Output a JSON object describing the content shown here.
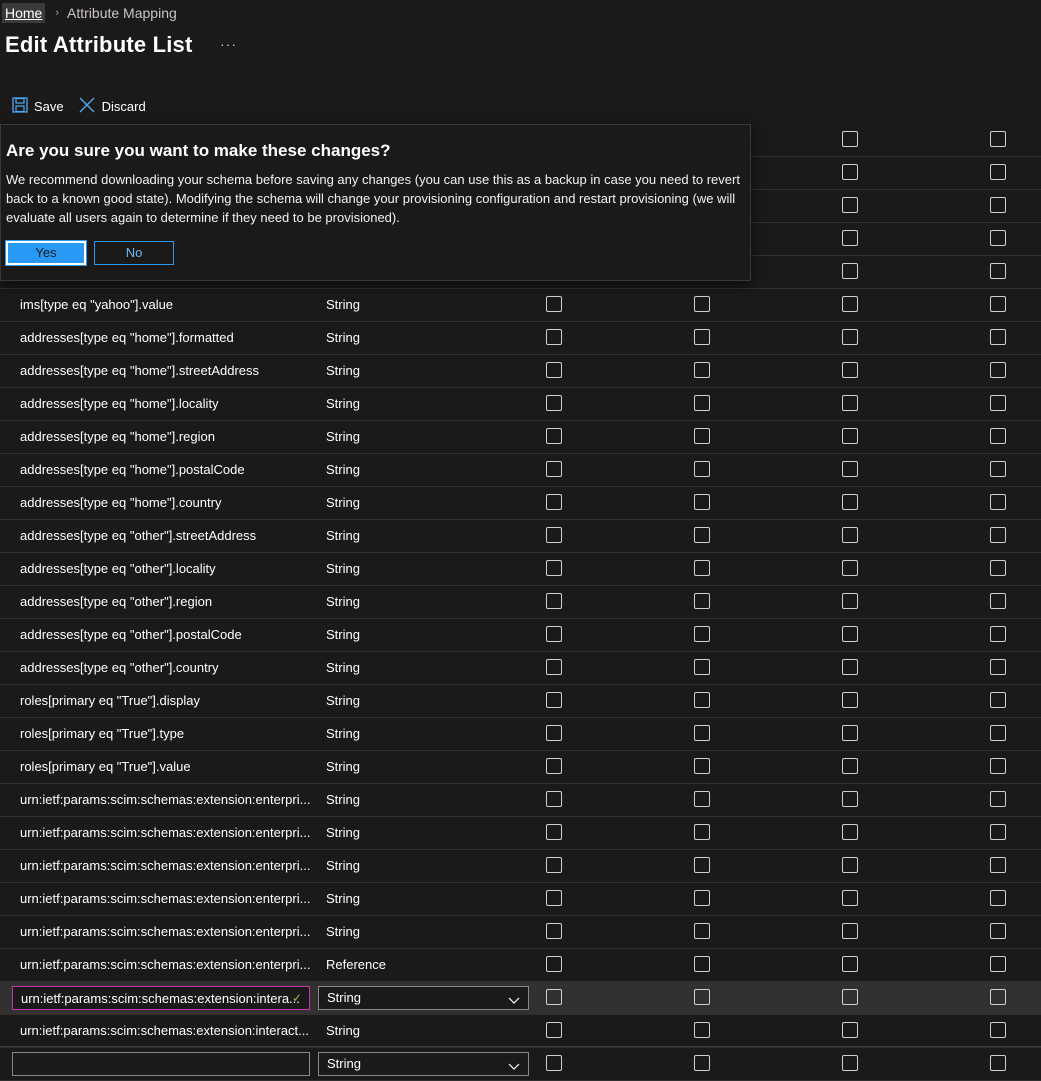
{
  "breadcrumb": {
    "home": "Home",
    "current": "Attribute Mapping"
  },
  "page": {
    "title": "Edit Attribute List",
    "more": "···"
  },
  "toolbar": {
    "save_label": "Save",
    "discard_label": "Discard"
  },
  "dialog": {
    "title": "Are you sure you want to make these changes?",
    "body": "We recommend downloading your schema before saving any changes (you can use this as a backup in case you need to revert back to a known good state). Modifying the schema will change your provisioning configuration and restart provisioning (we will evaluate all users again to determine if they need to be provisioned).",
    "yes_label": "Yes",
    "no_label": "No"
  },
  "rows": [
    {
      "name": "",
      "type": ""
    },
    {
      "name": "",
      "type": ""
    },
    {
      "name": "",
      "type": ""
    },
    {
      "name": "",
      "type": ""
    },
    {
      "name": "",
      "type": ""
    },
    {
      "name": "ims[type eq \"yahoo\"].value",
      "type": "String"
    },
    {
      "name": "addresses[type eq \"home\"].formatted",
      "type": "String"
    },
    {
      "name": "addresses[type eq \"home\"].streetAddress",
      "type": "String"
    },
    {
      "name": "addresses[type eq \"home\"].locality",
      "type": "String"
    },
    {
      "name": "addresses[type eq \"home\"].region",
      "type": "String"
    },
    {
      "name": "addresses[type eq \"home\"].postalCode",
      "type": "String"
    },
    {
      "name": "addresses[type eq \"home\"].country",
      "type": "String"
    },
    {
      "name": "addresses[type eq \"other\"].streetAddress",
      "type": "String"
    },
    {
      "name": "addresses[type eq \"other\"].locality",
      "type": "String"
    },
    {
      "name": "addresses[type eq \"other\"].region",
      "type": "String"
    },
    {
      "name": "addresses[type eq \"other\"].postalCode",
      "type": "String"
    },
    {
      "name": "addresses[type eq \"other\"].country",
      "type": "String"
    },
    {
      "name": "roles[primary eq \"True\"].display",
      "type": "String"
    },
    {
      "name": "roles[primary eq \"True\"].type",
      "type": "String"
    },
    {
      "name": "roles[primary eq \"True\"].value",
      "type": "String"
    },
    {
      "name": "urn:ietf:params:scim:schemas:extension:enterpri...",
      "type": "String"
    },
    {
      "name": "urn:ietf:params:scim:schemas:extension:enterpri...",
      "type": "String"
    },
    {
      "name": "urn:ietf:params:scim:schemas:extension:enterpri...",
      "type": "String"
    },
    {
      "name": "urn:ietf:params:scim:schemas:extension:enterpri...",
      "type": "String"
    },
    {
      "name": "urn:ietf:params:scim:schemas:extension:enterpri...",
      "type": "String"
    },
    {
      "name": "urn:ietf:params:scim:schemas:extension:enterpri...",
      "type": "Reference"
    }
  ],
  "edit_row": {
    "name_value": "urn:ietf:params:scim:schemas:extension:intera...",
    "type_value": "String"
  },
  "row_after_edit": {
    "name": "urn:ietf:params:scim:schemas:extension:interact...",
    "type": "String"
  },
  "new_row": {
    "name_value": "",
    "type_value": "String"
  },
  "colors": {
    "accent": "#2899f5",
    "focus": "#c239b3",
    "valid": "#92c353",
    "background": "#1b1a19"
  }
}
